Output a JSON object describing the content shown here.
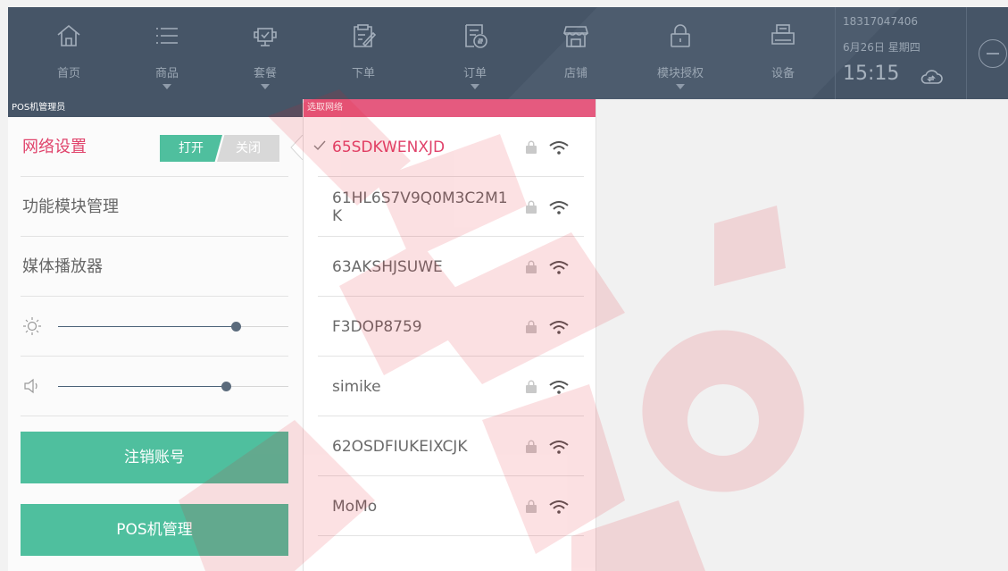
{
  "nav": {
    "items": [
      {
        "label": "首页",
        "icon": "home-icon",
        "has_dropdown": false
      },
      {
        "label": "商品",
        "icon": "list-icon",
        "has_dropdown": true
      },
      {
        "label": "套餐",
        "icon": "package-icon",
        "has_dropdown": true
      },
      {
        "label": "下单",
        "icon": "edit-order-icon",
        "has_dropdown": false
      },
      {
        "label": "订单",
        "icon": "bill-icon",
        "has_dropdown": true
      },
      {
        "label": "店铺",
        "icon": "store-icon",
        "has_dropdown": false
      },
      {
        "label": "模块授权",
        "icon": "lock-icon",
        "has_dropdown": true
      },
      {
        "label": "设备",
        "icon": "printer-icon",
        "has_dropdown": false
      }
    ]
  },
  "account": {
    "phone": "18317047406",
    "date": "6月26日 星期四",
    "time": "15:15"
  },
  "left_panel": {
    "header": "POS机管理员",
    "network_label": "网络设置",
    "toggle_on": "打开",
    "toggle_off": "关闭",
    "module_label": "功能模块管理",
    "media_label": "媒体播放器",
    "brightness": 0.77,
    "volume": 0.73,
    "logout_button": "注销账号",
    "pos_button": "POS机管理"
  },
  "wifi_panel": {
    "header": "选取网络",
    "networks": [
      {
        "name": "65SDKWENXJD",
        "selected": true
      },
      {
        "name": "61HL6S7V9Q0M3C2M1K",
        "selected": false
      },
      {
        "name": "63AKSHJSUWE",
        "selected": false
      },
      {
        "name": "F3DOP8759",
        "selected": false
      },
      {
        "name": "simike",
        "selected": false
      },
      {
        "name": "62OSDFIUKEIXCJK",
        "selected": false
      },
      {
        "name": "MoMo",
        "selected": false
      }
    ]
  },
  "colors": {
    "nav_bg": "#465567",
    "accent_green": "#4fbf9e",
    "accent_pink": "#e0436b",
    "wifi_strip": "#e55a7f"
  }
}
